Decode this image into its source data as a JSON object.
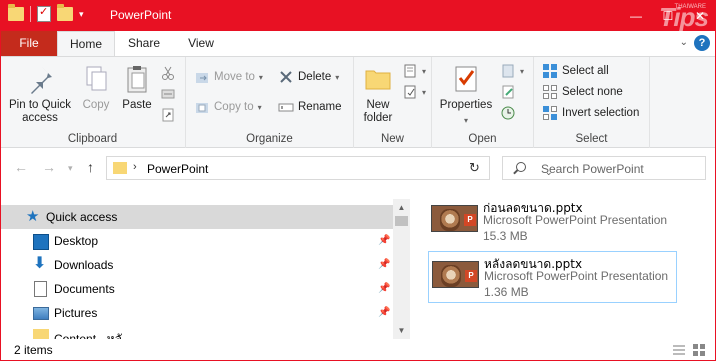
{
  "window": {
    "title": "PowerPoint",
    "watermark": "Tips",
    "watermark_small": "THAIWARE"
  },
  "tabs": [
    {
      "label": "File"
    },
    {
      "label": "Home"
    },
    {
      "label": "Share"
    },
    {
      "label": "View"
    }
  ],
  "ribbon": {
    "clipboard": {
      "label": "Clipboard",
      "pin_label": "Pin to Quick access",
      "copy_label": "Copy",
      "paste_label": "Paste"
    },
    "organize": {
      "label": "Organize",
      "move_to": "Move to",
      "copy_to": "Copy to",
      "delete": "Delete",
      "rename": "Rename"
    },
    "new": {
      "label": "New",
      "new_folder": "New folder"
    },
    "open": {
      "label": "Open",
      "properties": "Properties"
    },
    "select": {
      "label": "Select",
      "select_all": "Select all",
      "select_none": "Select none",
      "invert_selection": "Invert selection"
    }
  },
  "address": {
    "path": "PowerPoint",
    "search_placeholder": "Search PowerPoint"
  },
  "nav": {
    "items": [
      {
        "label": "Quick access"
      },
      {
        "label": "Desktop"
      },
      {
        "label": "Downloads"
      },
      {
        "label": "Documents"
      },
      {
        "label": "Pictures"
      },
      {
        "label": "Content - หลั"
      }
    ]
  },
  "files": [
    {
      "name": "ก่อนลดขนาด.pptx",
      "type": "Microsoft PowerPoint Presentation",
      "size": "15.3 MB"
    },
    {
      "name": "หลังลดขนาด.pptx",
      "type": "Microsoft PowerPoint Presentation",
      "size": "1.36 MB"
    }
  ],
  "status": {
    "item_count": "2 items"
  },
  "colors": {
    "titlebar": "#e81123",
    "file_tab": "#c42b1c",
    "selection": "#d9d9d9",
    "accent": "#1e73be"
  }
}
